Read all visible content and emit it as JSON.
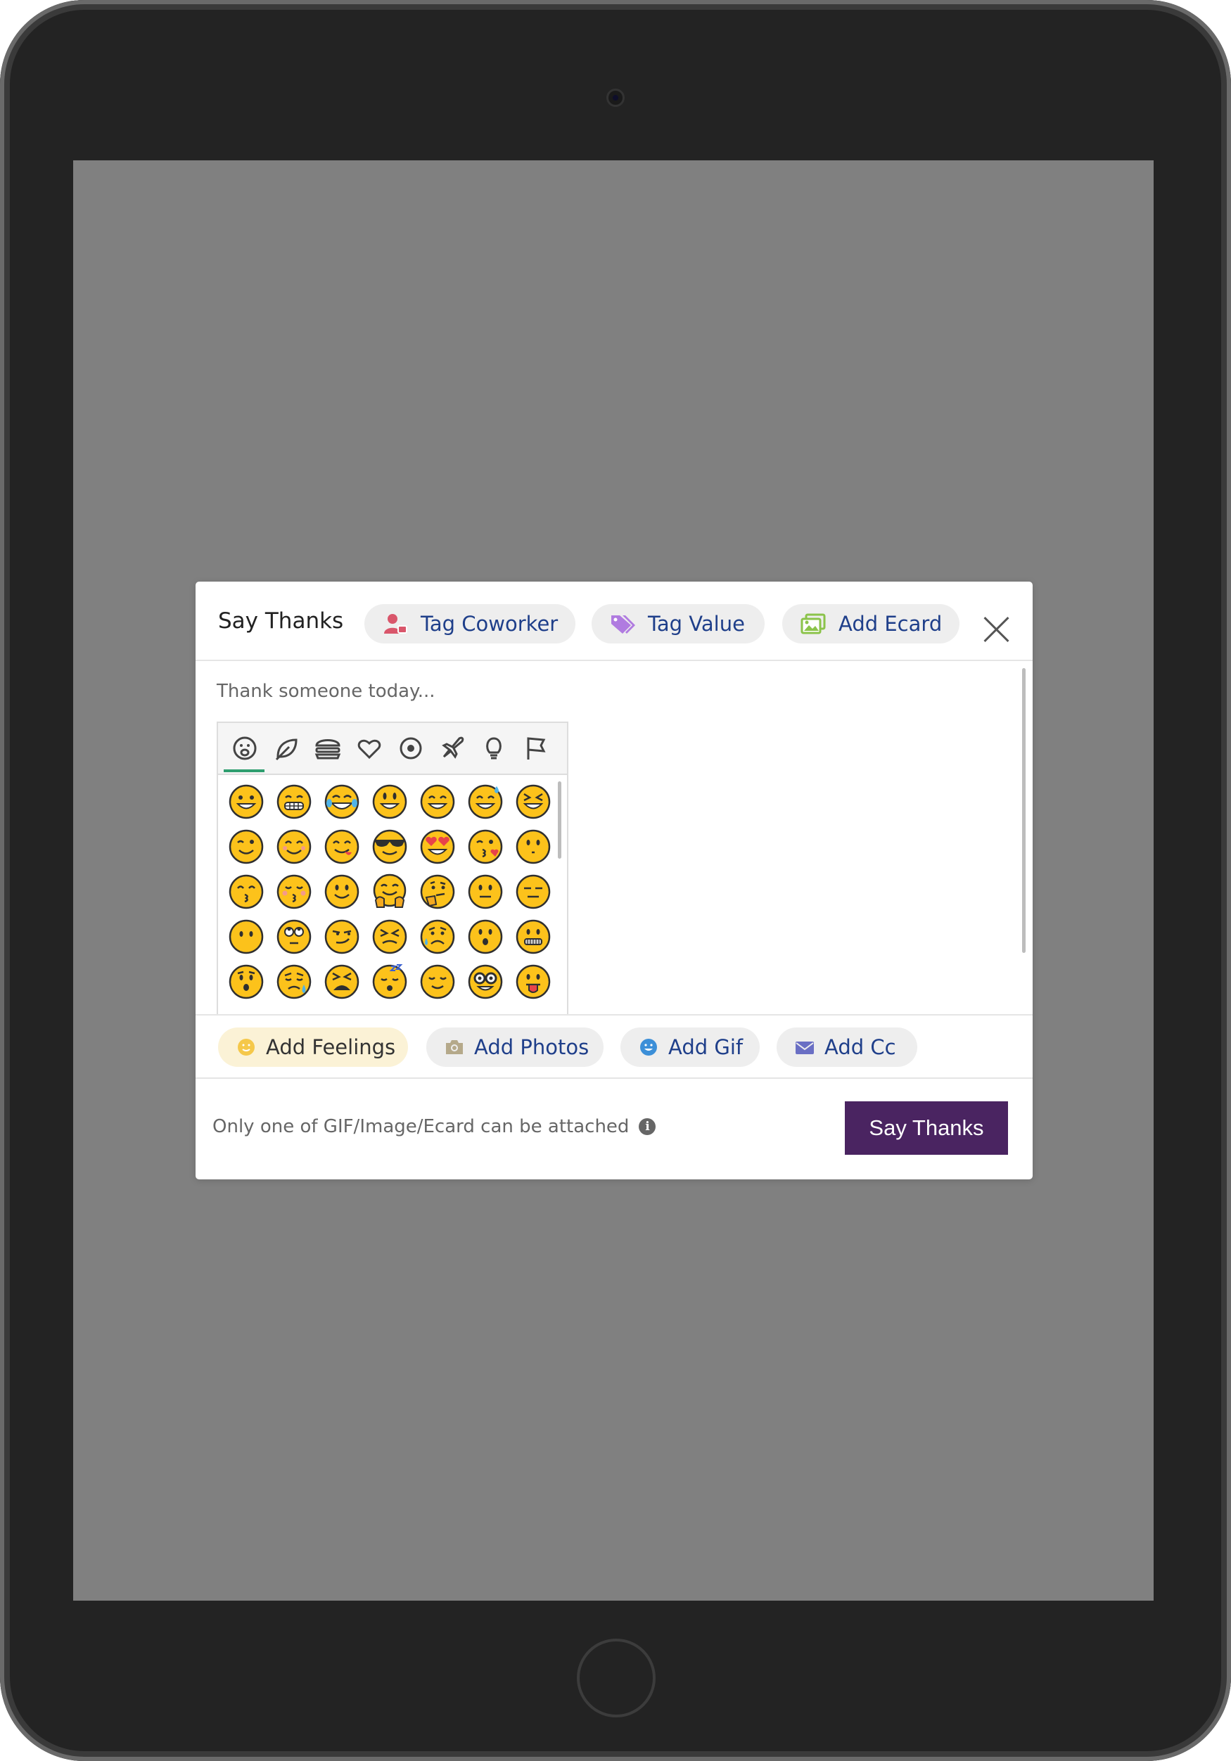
{
  "modal": {
    "title": "Say Thanks",
    "header_chips": [
      {
        "label": "Tag Coworker",
        "icon": "user-tag-icon",
        "color": "#d9566b"
      },
      {
        "label": "Tag Value",
        "icon": "tags-icon",
        "color": "#b07be0"
      },
      {
        "label": "Add Ecard",
        "icon": "images-icon",
        "color": "#8bc34a"
      }
    ],
    "placeholder": "Thank someone today...",
    "emoji_categories": [
      "smileys",
      "nature",
      "food",
      "activity",
      "travel-activity",
      "places",
      "objects",
      "flags"
    ],
    "emojis": [
      [
        "😀",
        "😁",
        "😂",
        "😃",
        "😄",
        "😅",
        "😆"
      ],
      [
        "😉",
        "😊",
        "😋",
        "😎",
        "😍",
        "😘",
        "🙂"
      ],
      [
        "😙",
        "😚",
        "🙂",
        "🤗",
        "🤔",
        "😐",
        "😑"
      ],
      [
        "😶",
        "🙄",
        "😏",
        "😣",
        "😥",
        "😮",
        "🤐"
      ],
      [
        "😯",
        "😪",
        "😫",
        "😴",
        "😌",
        "🤓",
        "😛"
      ]
    ],
    "action_chips": [
      {
        "label": "Add Feelings",
        "icon": "smiley-icon",
        "color": "#f5c84a"
      },
      {
        "label": "Add Photos",
        "icon": "camera-icon",
        "color": "#b5a98a"
      },
      {
        "label": "Add Gif",
        "icon": "gif-smiley-icon",
        "color": "#3c8fd8"
      },
      {
        "label": "Add Cc",
        "icon": "envelope-icon",
        "color": "#6a6fc4"
      }
    ],
    "footer_note": "Only one of GIF/Image/Ecard can be attached",
    "info_glyph": "i",
    "submit_label": "Say Thanks",
    "accent": "#4a2461"
  }
}
